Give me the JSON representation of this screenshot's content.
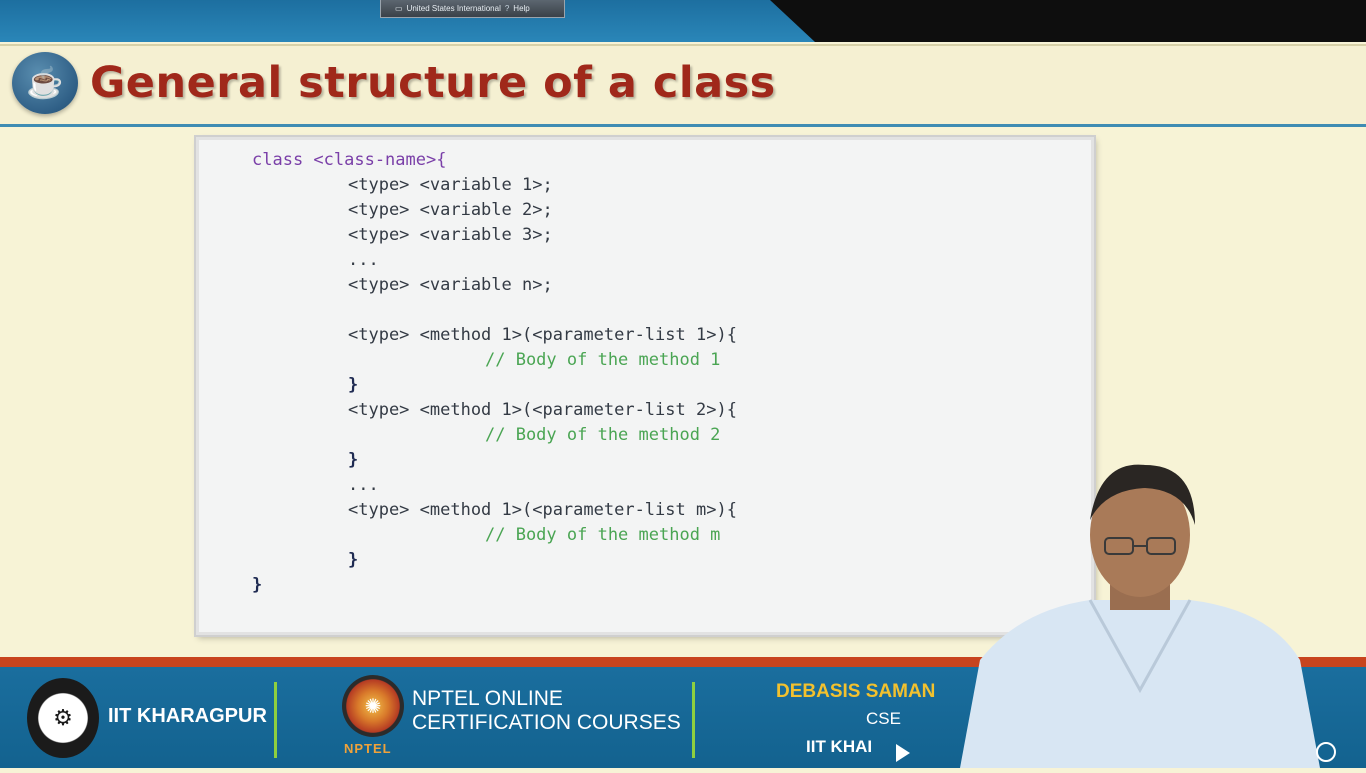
{
  "top_bar": {
    "language_indicator": "United States International",
    "help_label": "Help"
  },
  "slide": {
    "title": "General structure of a class",
    "logo_icon": "java-coffee-cup-icon",
    "code_lines": [
      "class <class-name>{",
      "<type> <variable 1>;",
      "<type> <variable 2>;",
      "<type> <variable 3>;",
      "...",
      "<type> <variable n>;",
      "",
      "<type> <method 1>(<parameter-list 1>){",
      "// Body of the method 1",
      "}",
      "<type> <method 1>(<parameter-list 2>){",
      "// Body of the method 2",
      "}",
      "...",
      "<type> <method 1>(<parameter-list m>){",
      "// Body of the method m",
      "}",
      "}"
    ]
  },
  "footer": {
    "iit_label": "IIT KHARAGPUR",
    "nptel_line1": "NPTEL ONLINE",
    "nptel_line2": "CERTIFICATION COURSES",
    "nptel_word": "NPTEL",
    "presenter_name": "DEBASIS SAMAN",
    "presenter_dept": "CSE",
    "presenter_inst": "IIT KHAI"
  },
  "colors": {
    "title": "#a0281a",
    "background": "#f7f3d6",
    "keyword": "#7a3fa8",
    "number": "#e07b2b",
    "comment": "#4aa553",
    "footer": "#1a6e9e",
    "accent_red": "#c8441e"
  }
}
